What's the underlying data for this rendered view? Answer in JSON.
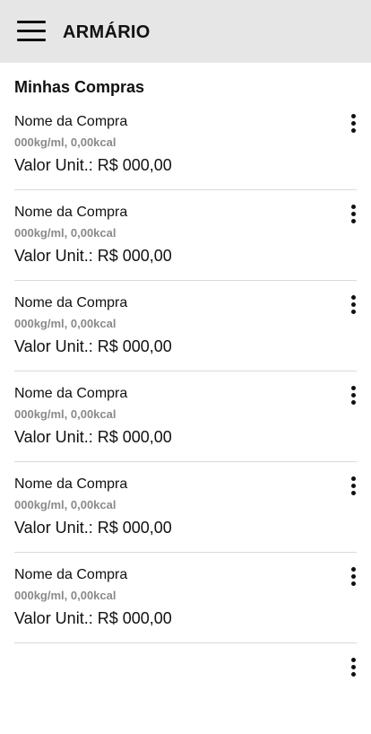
{
  "appbar": {
    "title": "ARMÁRIO",
    "menu_icon": "hamburger-menu-icon"
  },
  "section": {
    "title": "Minhas Compras"
  },
  "items": [
    {
      "name": "Nome da Compra",
      "details": "000kg/ml, 0,00kcal",
      "price": "Valor Unit.: R$ 000,00",
      "more_icon": "more-vertical-icon"
    },
    {
      "name": "Nome da Compra",
      "details": "000kg/ml, 0,00kcal",
      "price": "Valor Unit.: R$ 000,00",
      "more_icon": "more-vertical-icon"
    },
    {
      "name": "Nome da Compra",
      "details": "000kg/ml, 0,00kcal",
      "price": "Valor Unit.: R$ 000,00",
      "more_icon": "more-vertical-icon"
    },
    {
      "name": "Nome da Compra",
      "details": "000kg/ml, 0,00kcal",
      "price": "Valor Unit.: R$ 000,00",
      "more_icon": "more-vertical-icon"
    },
    {
      "name": "Nome da Compra",
      "details": "000kg/ml, 0,00kcal",
      "price": "Valor Unit.: R$ 000,00",
      "more_icon": "more-vertical-icon"
    },
    {
      "name": "Nome da Compra",
      "details": "000kg/ml, 0,00kcal",
      "price": "Valor Unit.: R$ 000,00",
      "more_icon": "more-vertical-icon"
    },
    {
      "name": "",
      "details": "",
      "price": "",
      "more_icon": "more-vertical-icon"
    }
  ],
  "colors": {
    "appbar_bg": "#e6e6e6",
    "secondary_text": "#8a8a8a",
    "divider": "#d9d9d9"
  }
}
